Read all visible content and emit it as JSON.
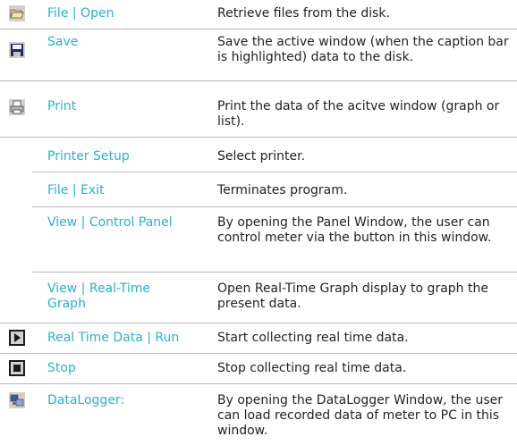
{
  "rows": [
    {
      "command": "File | Open",
      "description": "Retrieve files from the disk.",
      "icon": "folder-open-icon"
    },
    {
      "command": "Save",
      "description": "Save the active window (when the caption bar is highlighted) data to the disk.",
      "icon": "floppy-disk-icon"
    },
    {
      "command": "Print",
      "description": "Print the data of the acitve window (graph or list).",
      "icon": "printer-icon"
    },
    {
      "command": "Printer Setup",
      "description": "Select printer.",
      "icon": ""
    },
    {
      "command": "File | Exit",
      "description": "Terminates program.",
      "icon": ""
    },
    {
      "command": "View | Control Panel",
      "description": "By opening the Panel Window, the user can control meter via the button in this window.",
      "icon": ""
    },
    {
      "command": "View | Real-Time Graph",
      "description": "Open Real-Time Graph display to graph the present data.",
      "icon": ""
    },
    {
      "command": "Real Time Data | Run",
      "description": "Start collecting real time data.",
      "icon": "run-icon"
    },
    {
      "command": "Stop",
      "description": "Stop collecting real time data.",
      "icon": "stop-icon"
    },
    {
      "command": "DataLogger:",
      "description": "By opening the DataLogger Window, the user can load recorded data of meter to PC in this window.",
      "icon": "datalogger-icon"
    }
  ],
  "colors": {
    "command_text": "#2ab0d0",
    "description_text": "#231f20",
    "rule": "#b9b9b9",
    "icon_frame": "#bfbfbf"
  }
}
